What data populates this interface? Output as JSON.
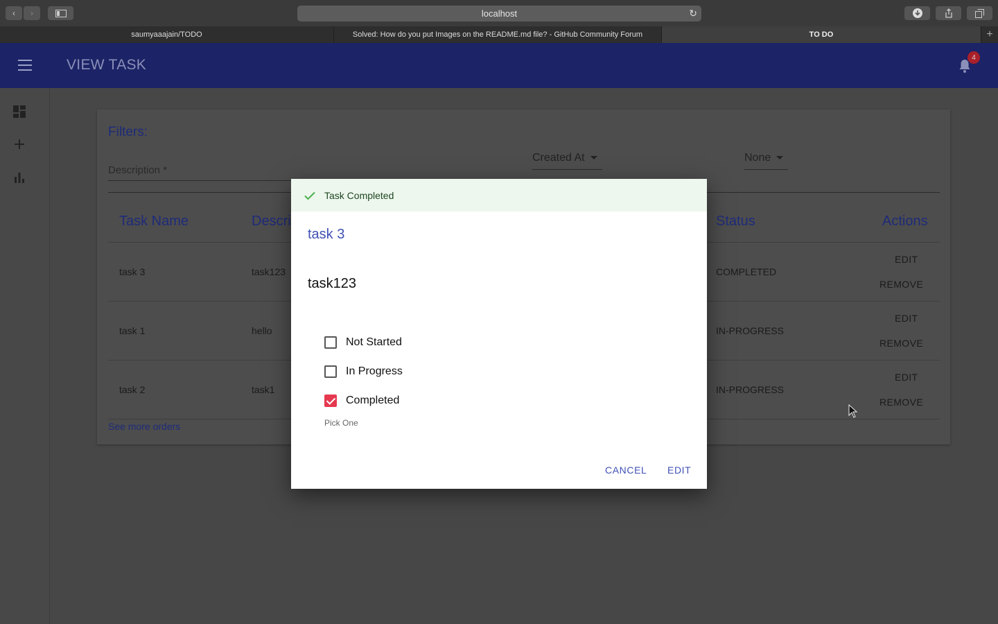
{
  "browser": {
    "url": "localhost",
    "tabs": [
      {
        "label": "saumyaaajain/TODO",
        "active": false
      },
      {
        "label": "Solved: How do you put Images on the README.md file? - GitHub Community Forum",
        "active": false
      },
      {
        "label": "TO DO",
        "active": true
      }
    ]
  },
  "appbar": {
    "title": "VIEW TASK",
    "notification_count": "4"
  },
  "sidebar": {
    "items": [
      {
        "icon": "dashboard-icon"
      },
      {
        "icon": "add-icon"
      },
      {
        "icon": "bar-chart-icon"
      }
    ]
  },
  "filters": {
    "title": "Filters:",
    "description_label": "Description *",
    "sort_by": "Created At",
    "status_filter": "None"
  },
  "table": {
    "headers": [
      "Task Name",
      "Descri",
      "Status",
      "Actions"
    ],
    "rows": [
      {
        "name": "task 3",
        "description": "task123",
        "status": "COMPLETED"
      },
      {
        "name": "task 1",
        "description": "hello",
        "status": "IN-PROGRESS"
      },
      {
        "name": "task 2",
        "description": "task1",
        "status": "IN-PROGRESS"
      }
    ],
    "edit_label": "EDIT",
    "remove_label": "REMOVE",
    "see_more": "See more orders"
  },
  "dialog": {
    "toast": "Task Completed",
    "title": "task 3",
    "description": "task123",
    "options": [
      {
        "label": "Not Started",
        "checked": false
      },
      {
        "label": "In Progress",
        "checked": false
      },
      {
        "label": "Completed",
        "checked": true
      }
    ],
    "helper": "Pick One",
    "cancel": "CANCEL",
    "edit": "EDIT"
  },
  "colors": {
    "appbar": "#1c2366",
    "primary": "#3f51b5",
    "checked": "#e53950",
    "toast_bg": "#edf7ed"
  }
}
